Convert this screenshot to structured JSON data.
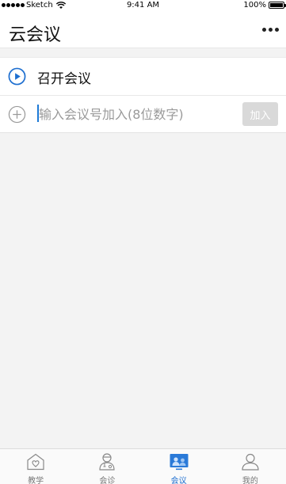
{
  "status_bar": {
    "carrier": "Sketch",
    "time": "9:41 AM",
    "battery": "100%"
  },
  "nav": {
    "title": "云会议"
  },
  "start_meeting": {
    "label": "召开会议",
    "icon": "play-circle-icon"
  },
  "join_meeting": {
    "placeholder": "输入会议号加入(8位数字)",
    "value": "",
    "button_label": "加入",
    "icon": "plus-circle-icon"
  },
  "tabs": [
    {
      "label": "教学",
      "icon": "teaching-icon",
      "active": false
    },
    {
      "label": "会诊",
      "icon": "consultation-icon",
      "active": false
    },
    {
      "label": "会议",
      "icon": "meeting-icon",
      "active": true
    },
    {
      "label": "我的",
      "icon": "profile-icon",
      "active": false
    }
  ],
  "colors": {
    "accent": "#1e6fd0",
    "background": "#f3f3f3",
    "join_button_bg": "#d9d9d9"
  }
}
